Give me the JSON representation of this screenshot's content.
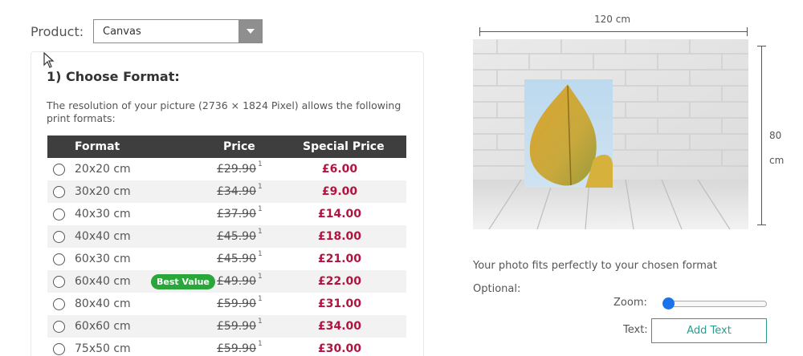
{
  "product": {
    "label": "Product:",
    "selected": "Canvas"
  },
  "panel": {
    "title": "1) Choose Format:",
    "description": "The resolution of your picture (2736 × 1824 Pixel) allows the following print formats:"
  },
  "table": {
    "headers": {
      "format": "Format",
      "price": "Price",
      "special": "Special Price"
    },
    "rows": [
      {
        "format": "20x20 cm",
        "badge": "",
        "price": "£29.90",
        "note": "1",
        "special": "£6.00"
      },
      {
        "format": "30x20 cm",
        "badge": "",
        "price": "£34.90",
        "note": "1",
        "special": "£9.00"
      },
      {
        "format": "40x30 cm",
        "badge": "",
        "price": "£37.90",
        "note": "1",
        "special": "£14.00"
      },
      {
        "format": "40x40 cm",
        "badge": "",
        "price": "£45.90",
        "note": "1",
        "special": "£18.00"
      },
      {
        "format": "60x30 cm",
        "badge": "",
        "price": "£45.90",
        "note": "1",
        "special": "£21.00"
      },
      {
        "format": "60x40 cm",
        "badge": "Best Value",
        "price": "£49.90",
        "note": "1",
        "special": "£22.00"
      },
      {
        "format": "80x40 cm",
        "badge": "",
        "price": "£59.90",
        "note": "1",
        "special": "£31.00"
      },
      {
        "format": "60x60 cm",
        "badge": "",
        "price": "£59.90",
        "note": "1",
        "special": "£34.00"
      },
      {
        "format": "75x50 cm",
        "badge": "",
        "price": "£59.90",
        "note": "1",
        "special": "£30.00"
      }
    ]
  },
  "preview": {
    "width_label": "120 cm",
    "height_num": "80",
    "height_unit": "cm",
    "fit_text": "Your photo fits perfectly to your chosen format",
    "optional_label": "Optional:",
    "zoom_label": "Zoom:",
    "zoom_value": 0,
    "text_label": "Text:",
    "add_text_button": "Add Text"
  },
  "colors": {
    "header_bg": "#3e3e3e",
    "special_price": "#b5133f",
    "badge": "#2aa63a",
    "accent": "#2a9d8f",
    "slider_thumb": "#1a73e8"
  }
}
